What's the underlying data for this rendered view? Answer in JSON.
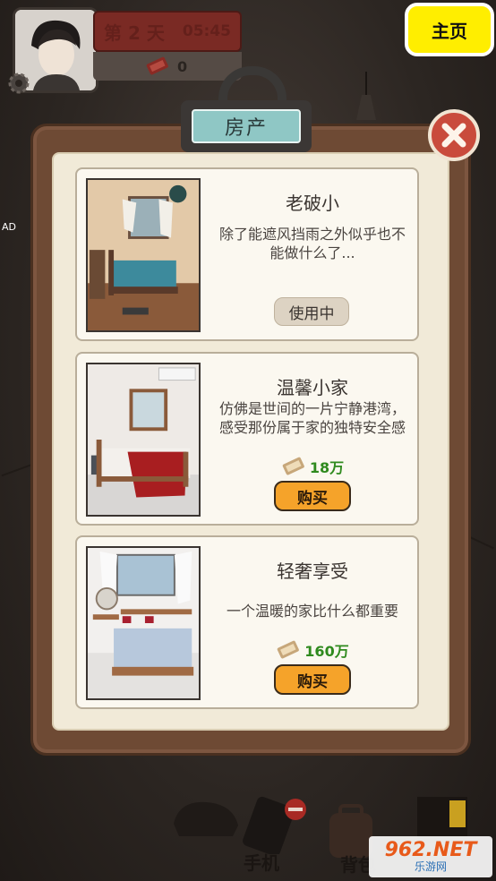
{
  "hud": {
    "day": "第 2 天",
    "time": "05:45",
    "money": "0",
    "home_button": "主页",
    "ad": "AD"
  },
  "dialog": {
    "title": "房产",
    "cards": [
      {
        "name": "老破小",
        "desc": "除了能遮风挡雨之外似乎也不能做什么了...",
        "status": "使用中"
      },
      {
        "name": "温馨小家",
        "desc": "仿佛是世间的一片宁静港湾，感受那份属于家的独特安全感",
        "price": "18万",
        "button": "购买"
      },
      {
        "name": "轻奢享受",
        "desc": "一个温暖的家比什么都重要",
        "price": "160万",
        "button": "购买"
      }
    ]
  },
  "bottom": {
    "phone": "手机",
    "bag": "背包"
  },
  "watermark": {
    "top": "962.NET",
    "bottom": "乐游网"
  },
  "colors": {
    "home_button": "#ffee00",
    "buy_button": "#f5a32a",
    "price_text": "#2f8a1e",
    "close_button": "#c94b3c",
    "title_tab": "#8fc7c5"
  }
}
